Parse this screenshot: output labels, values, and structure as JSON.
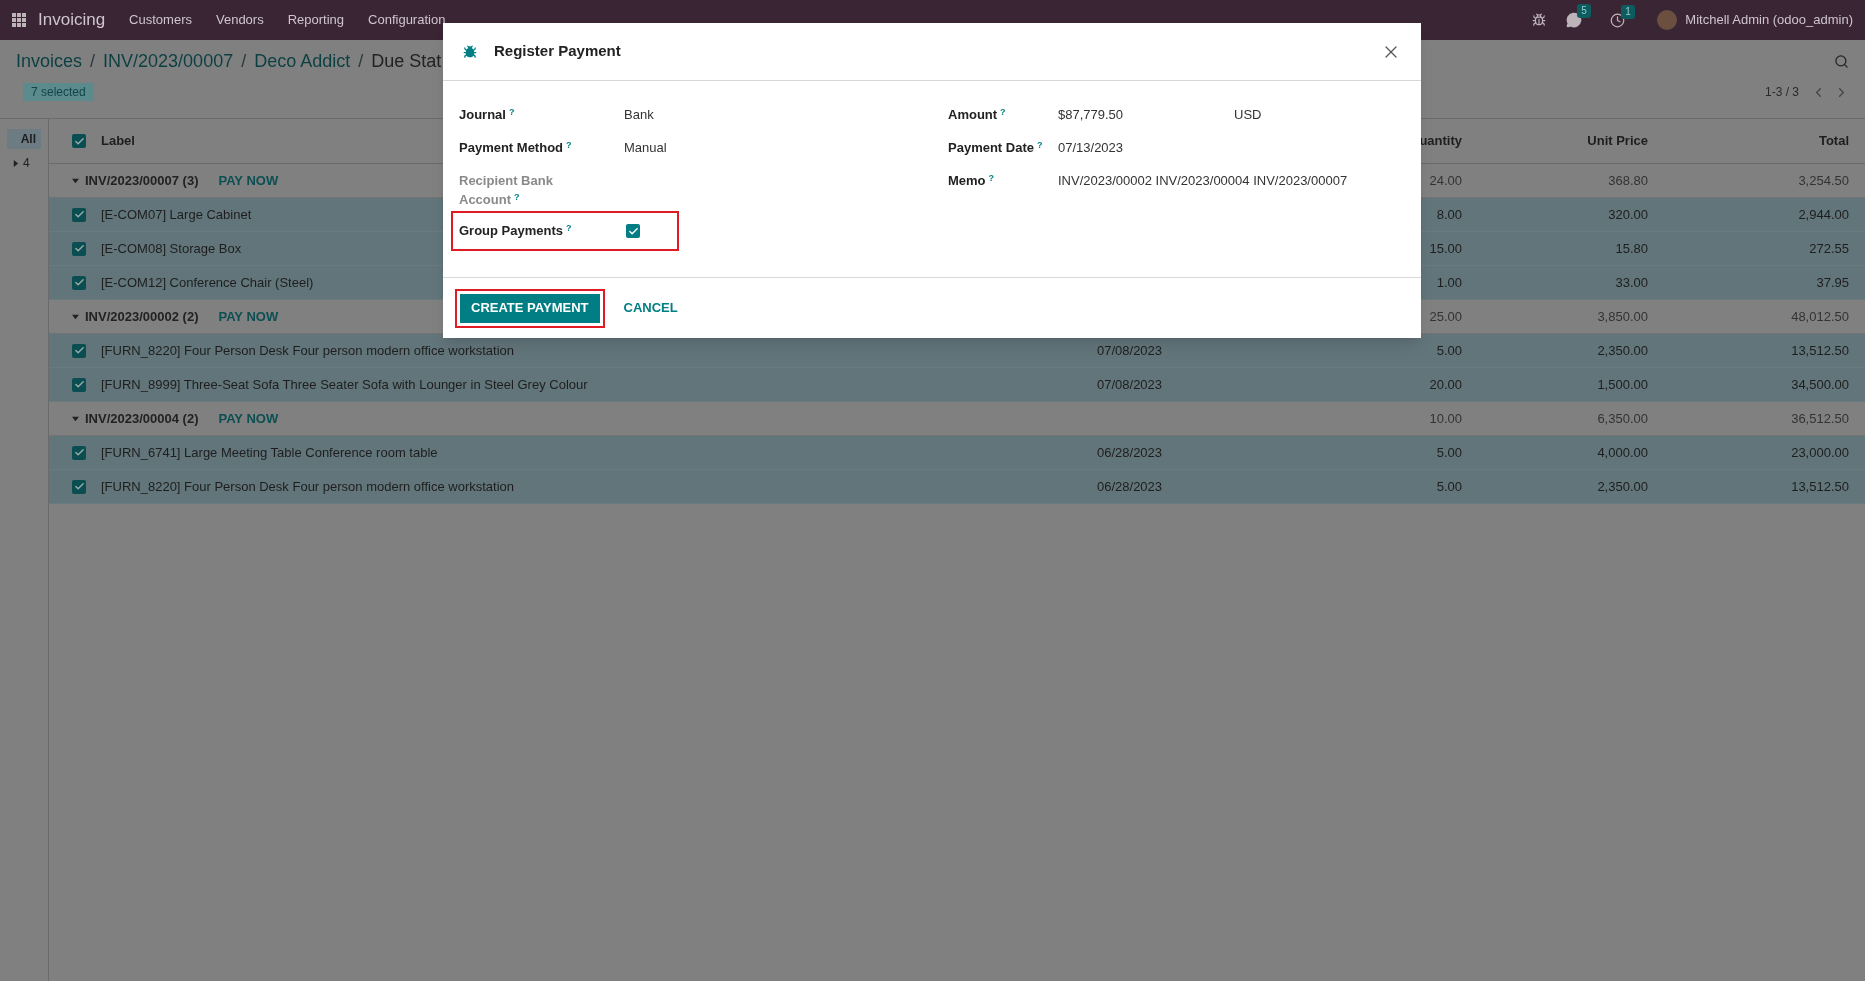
{
  "navbar": {
    "app": "Invoicing",
    "menus": [
      "Customers",
      "Vendors",
      "Reporting",
      "Configuration"
    ],
    "chat_count": "5",
    "activity_count": "1",
    "user": "Mitchell Admin (odoo_admin)"
  },
  "breadcrumbs": [
    {
      "label": "Invoices",
      "current": false
    },
    {
      "separator": "/",
      "label": "INV/2023/00007",
      "current": false
    },
    {
      "separator": "/",
      "label": "Deco Addict",
      "current": false
    },
    {
      "separator": "/",
      "label": "Due Stat",
      "current": true
    }
  ],
  "selection_badge": "7 selected",
  "pager": "1-3 / 3",
  "sidebar": {
    "items": [
      {
        "label": "All",
        "kind": "plain",
        "selected": true
      },
      {
        "label": "4",
        "kind": "collapsible",
        "selected": false
      }
    ]
  },
  "table": {
    "header_checked": true,
    "column_headers": {
      "label": "Label",
      "quantity": "uantity",
      "unit_price": "Unit Price",
      "total": "Total"
    },
    "groups": [
      {
        "name": "INV/2023/00007 (3)",
        "action": "PAY NOW",
        "expanded": true,
        "quantity": "24.00",
        "unit_price": "368.80",
        "total": "3,254.50",
        "lines": [
          {
            "label": "[E-COM07] Large Cabinet",
            "checked": true,
            "quantity": "8.00",
            "unit_price": "320.00",
            "total": "2,944.00"
          },
          {
            "label": "[E-COM08] Storage Box",
            "checked": true,
            "quantity": "15.00",
            "unit_price": "15.80",
            "total": "272.55"
          },
          {
            "label": "[E-COM12] Conference Chair (Steel)",
            "checked": true,
            "quantity": "1.00",
            "unit_price": "33.00",
            "total": "37.95"
          }
        ]
      },
      {
        "name": "INV/2023/00002 (2)",
        "action": "PAY NOW",
        "expanded": true,
        "quantity": "25.00",
        "unit_price": "3,850.00",
        "total": "48,012.50",
        "lines": [
          {
            "label": "[FURN_8220] Four Person Desk Four person modern office workstation",
            "checked": true,
            "date": "07/08/2023",
            "quantity": "5.00",
            "unit_price": "2,350.00",
            "total": "13,512.50"
          },
          {
            "label": "[FURN_8999] Three-Seat Sofa Three Seater Sofa with Lounger in Steel Grey Colour",
            "checked": true,
            "date": "07/08/2023",
            "quantity": "20.00",
            "unit_price": "1,500.00",
            "total": "34,500.00"
          }
        ]
      },
      {
        "name": "INV/2023/00004 (2)",
        "action": "PAY NOW",
        "expanded": true,
        "quantity": "10.00",
        "unit_price": "6,350.00",
        "total": "36,512.50",
        "lines": [
          {
            "label": "[FURN_6741] Large Meeting Table Conference room table",
            "checked": true,
            "date": "06/28/2023",
            "quantity": "5.00",
            "unit_price": "4,000.00",
            "total": "23,000.00"
          },
          {
            "label": "[FURN_8220] Four Person Desk Four person modern office workstation",
            "checked": true,
            "date": "06/28/2023",
            "quantity": "5.00",
            "unit_price": "2,350.00",
            "total": "13,512.50"
          }
        ]
      }
    ]
  },
  "dialog": {
    "title": "Register Payment",
    "left_fields": [
      {
        "label": "Journal",
        "help": "?",
        "kind": "text",
        "value": "Bank",
        "disabled": false,
        "highlighted": false
      },
      {
        "label": "Payment Method",
        "help": "?",
        "kind": "text",
        "value": "Manual",
        "disabled": false,
        "highlighted": false
      },
      {
        "label": "Recipient Bank Account",
        "help": "?",
        "kind": "text",
        "disabled": true,
        "highlighted": false
      },
      {
        "label": "Group Payments",
        "help": "?",
        "kind": "checkbox",
        "checked": true,
        "disabled": false,
        "highlighted": true
      }
    ],
    "right_fields": [
      {
        "label": "Amount",
        "help": "?",
        "value": "$87,779.50",
        "currency": "USD"
      },
      {
        "label": "Payment Date",
        "help": "?",
        "value": "07/13/2023"
      },
      {
        "label": "Memo",
        "help": "?",
        "value": "INV/2023/00002 INV/2023/00004 INV/2023/00007"
      }
    ],
    "buttons": [
      {
        "label": "CREATE PAYMENT",
        "kind": "primary",
        "highlighted": true
      },
      {
        "label": "CANCEL",
        "kind": "link",
        "highlighted": false
      }
    ]
  }
}
